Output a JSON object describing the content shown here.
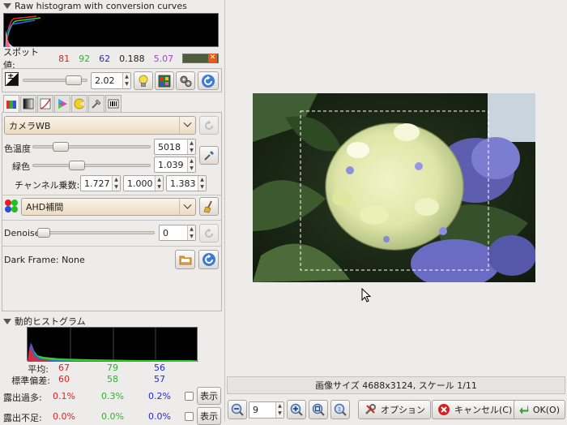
{
  "raw_histogram": {
    "title": "Raw histogram with conversion curves"
  },
  "spot": {
    "label": "スポット値:",
    "r": "81",
    "g": "92",
    "b": "62",
    "lum": "0.188",
    "ev": "5.07",
    "swatch_color": "#4f5e3a"
  },
  "exposure": {
    "value": "2.02"
  },
  "wb": {
    "preset": "カメラWB",
    "temp_label": "色温度",
    "temp_value": "5018",
    "green_label": "緑色",
    "green_value": "1.039",
    "channel_label": "チャンネル乗数:",
    "mult": [
      "1.727",
      "1.000",
      "1.383"
    ]
  },
  "interpolation": {
    "value": "AHD補間"
  },
  "denoise": {
    "label": "Denoise",
    "value": "0"
  },
  "dark_frame": {
    "label": "Dark Frame: None"
  },
  "live_histogram": {
    "title": "動的ヒストグラム",
    "rows": [
      {
        "label": "平均:",
        "r": "67",
        "g": "79",
        "b": "56"
      },
      {
        "label": "標準偏差:",
        "r": "60",
        "g": "58",
        "b": "57"
      },
      {
        "label": "露出過多:",
        "r": "0.1%",
        "g": "0.3%",
        "b": "0.2%",
        "button": "表示"
      },
      {
        "label": "露出不足:",
        "r": "0.0%",
        "g": "0.0%",
        "b": "0.0%",
        "button": "表示"
      }
    ]
  },
  "status": {
    "text": "画像サイズ 4688x3124, スケール 1/11"
  },
  "toolbar": {
    "zoom_value": "9",
    "options_label": "オプション",
    "cancel_label": "キャンセル(C)",
    "ok_label": "OK(O)"
  },
  "colors": {
    "red": "#e02020",
    "green": "#3cc83c",
    "blue": "#2828d8",
    "purple": "#a040d0",
    "accent_blue": "#3a7bd5"
  }
}
